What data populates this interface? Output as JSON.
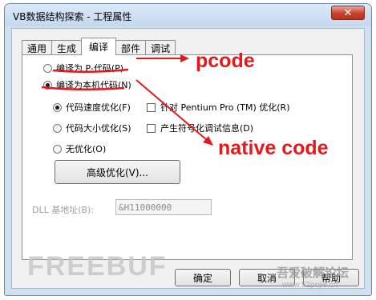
{
  "window": {
    "title": "VB数据结构探索 - 工程属性",
    "close_label": "✕"
  },
  "tabs": [
    {
      "label": "通用"
    },
    {
      "label": "生成"
    },
    {
      "label": "编译",
      "active": true
    },
    {
      "label": "部件"
    },
    {
      "label": "调试"
    }
  ],
  "compile": {
    "pcode_label": "编译为 P-代码(P)",
    "native_label": "编译为本机代码(N)",
    "selected": "native",
    "opt_speed": "代码速度优化(F)",
    "opt_size": "代码大小优化(S)",
    "opt_none": "无优化(O)",
    "opt_selected": "speed",
    "pentium_label": "针对 Pentium Pro (TM) 优化(R)",
    "debug_label": "产生符号化调试信息(D)",
    "advanced_button": "高级优化(V)...",
    "dll_label": "DLL 基地址(B):",
    "dll_value": "&H11000000"
  },
  "buttons": {
    "ok": "确定",
    "cancel": "取消",
    "help": "帮助"
  },
  "annotations": {
    "pcode": "pcode",
    "native": "native code",
    "color": "#e8171b"
  },
  "watermarks": {
    "left": "FREEBUF",
    "right": "吾爱破解论坛",
    "url": "www.52pojie.cn"
  }
}
